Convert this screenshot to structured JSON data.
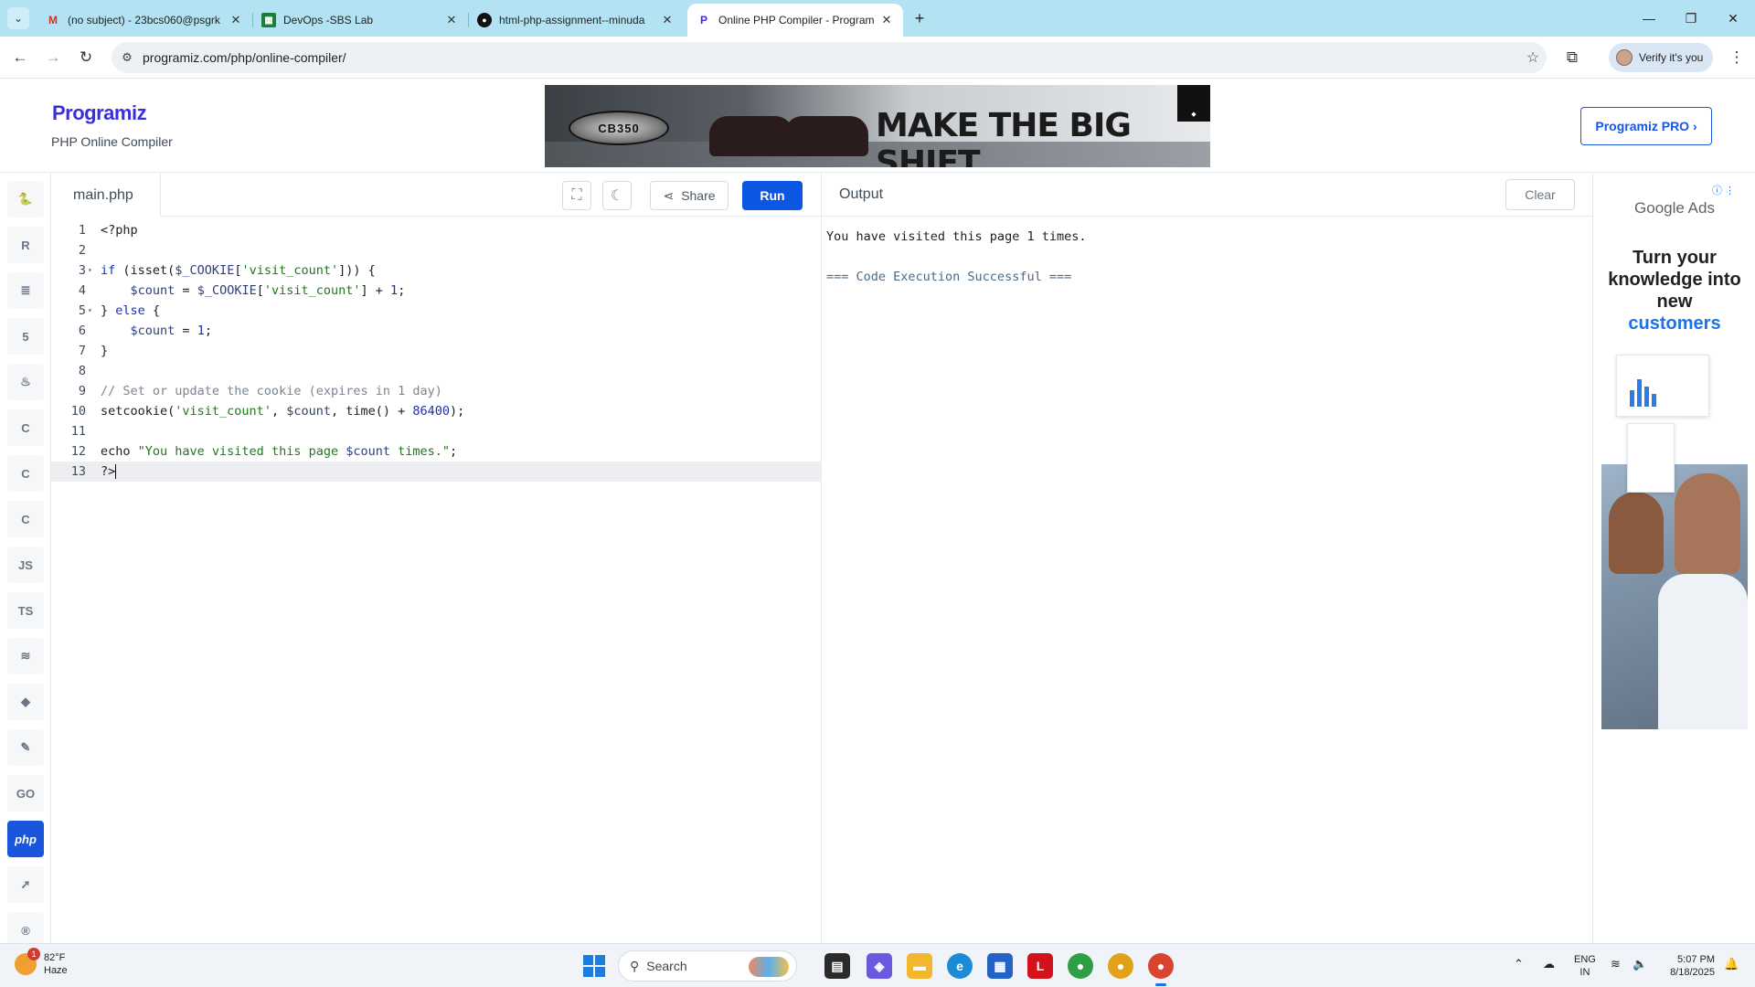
{
  "browser": {
    "tabs": [
      {
        "title": "(no subject) - 23bcs060@psgrk",
        "favicon": "gmail-icon"
      },
      {
        "title": "DevOps -SBS Lab",
        "favicon": "sheets-icon"
      },
      {
        "title": "html-php-assignment--minuda",
        "favicon": "github-icon"
      },
      {
        "title": "Online PHP Compiler - Program",
        "favicon": "programiz-icon",
        "active": true
      }
    ],
    "url": "programiz.com/php/online-compiler/",
    "profile_label": "Verify it's you"
  },
  "site": {
    "logo": "Programiz",
    "subtitle": "PHP Online Compiler",
    "pro_button": "Programiz PRO ›",
    "ad_headline": "MAKE THE BIG SHIFT",
    "ad_badge": "CB350"
  },
  "rail": {
    "items": [
      {
        "name": "python",
        "glyph": "🐍"
      },
      {
        "name": "r",
        "glyph": "R"
      },
      {
        "name": "sql",
        "glyph": "≣"
      },
      {
        "name": "html",
        "glyph": "5"
      },
      {
        "name": "java",
        "glyph": "♨"
      },
      {
        "name": "c",
        "glyph": "C"
      },
      {
        "name": "cpp",
        "glyph": "C"
      },
      {
        "name": "csharp",
        "glyph": "C"
      },
      {
        "name": "js",
        "glyph": "JS"
      },
      {
        "name": "ts",
        "glyph": "TS"
      },
      {
        "name": "go-lang",
        "glyph": "≋"
      },
      {
        "name": "ruby",
        "glyph": "◆"
      },
      {
        "name": "swift",
        "glyph": "✎"
      },
      {
        "name": "go",
        "glyph": "GO"
      },
      {
        "name": "php",
        "glyph": "php",
        "active": true
      },
      {
        "name": "swift2",
        "glyph": "➚"
      },
      {
        "name": "rust",
        "glyph": "®"
      }
    ]
  },
  "editor": {
    "filename": "main.php",
    "share_label": "Share",
    "run_label": "Run",
    "lines": [
      {
        "n": "1",
        "fold": "",
        "html": "&lt;?php"
      },
      {
        "n": "2",
        "fold": "",
        "html": ""
      },
      {
        "n": "3",
        "fold": "▾",
        "html": "<span class='kw'>if</span> (isset(<span class='var'>$_COOKIE</span>[<span class='str'>'visit_count'</span>])) {"
      },
      {
        "n": "4",
        "fold": "",
        "html": "    <span class='var'>$count</span> = <span class='var'>$_COOKIE</span>[<span class='str'>'visit_count'</span>] + <span class='num'>1</span>;"
      },
      {
        "n": "5",
        "fold": "▾",
        "html": "} <span class='kw'>else</span> {"
      },
      {
        "n": "6",
        "fold": "",
        "html": "    <span class='var'>$count</span> = <span class='num'>1</span>;"
      },
      {
        "n": "7",
        "fold": "",
        "html": "}"
      },
      {
        "n": "8",
        "fold": "",
        "html": ""
      },
      {
        "n": "9",
        "fold": "",
        "html": "<span class='cmt'>// Set or update the cookie (expires in 1 day)</span>"
      },
      {
        "n": "10",
        "fold": "",
        "html": "setcookie(<span class='str'>'visit_count'</span>, <span class='var'>$count</span>, time() + <span class='num'>86400</span>);"
      },
      {
        "n": "11",
        "fold": "",
        "html": ""
      },
      {
        "n": "12",
        "fold": "",
        "html": "echo <span class='str'>\"You have visited this page <span class='var'>$count</span> times.\"</span>;"
      },
      {
        "n": "13",
        "fold": "",
        "html": "?&gt;<span class='cursor'></span>",
        "current": true
      }
    ]
  },
  "output": {
    "title": "Output",
    "clear_label": "Clear",
    "lines": [
      "You have visited this page 1 times.",
      "",
      "=== Code Execution Successful ==="
    ]
  },
  "side_ad": {
    "brand": "Google Ads",
    "headline_1": "Turn your knowledge into new",
    "headline_2": "customers"
  },
  "taskbar": {
    "temperature": "82°F",
    "weather": "Haze",
    "weather_badge": "1",
    "search_placeholder": "Search",
    "lang_1": "ENG",
    "lang_2": "IN",
    "time": "5:07 PM",
    "date": "8/18/2025"
  }
}
